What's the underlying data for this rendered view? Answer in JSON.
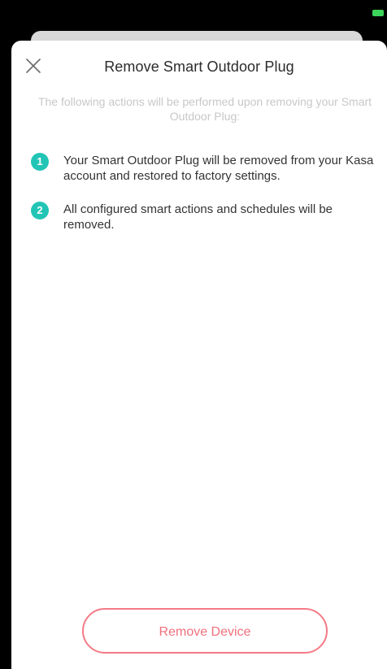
{
  "dialog": {
    "title": "Remove Smart Outdoor Plug",
    "subtitle": "The following actions will be performed upon removing your Smart Outdoor Plug:",
    "steps": [
      {
        "number": "1",
        "text": "Your Smart Outdoor Plug will be removed from your Kasa account and restored to factory settings."
      },
      {
        "number": "2",
        "text": "All configured smart actions and schedules will be removed."
      }
    ],
    "remove_button_label": "Remove Device",
    "close_icon": "close-icon"
  },
  "colors": {
    "accent_teal": "#22c5b5",
    "danger_outline": "#f47a86",
    "battery_green": "#3cd45a"
  }
}
